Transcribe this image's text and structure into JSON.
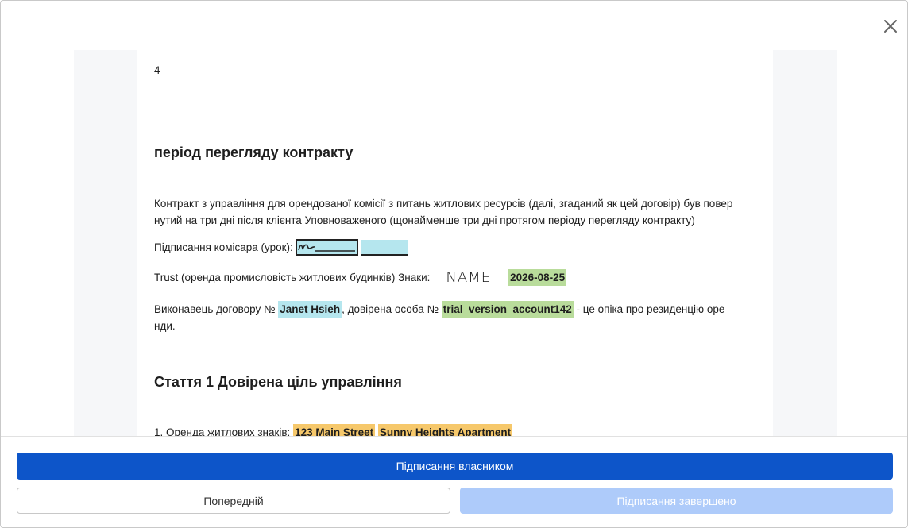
{
  "document": {
    "page_number": "4",
    "section_title": "період перегляду контракту",
    "paragraph_line1": "Контракт з управління для орендованої комісії з питань житлових ресурсів (далі, згаданий як цей договір) був повер",
    "paragraph_line2": "нутий на три дні після клієнта Уповноваженого (щонайменше три дні протягом періоду перегляду контракту)",
    "signature_label": "Підписання комісара (урок):",
    "trust_label": "Trust (оренда промисловість житлових будинків) Знаки:",
    "name_stamp": "NAME",
    "trust_date": "2026-08-25",
    "executor_prefix": "Виконавець договору №",
    "executor_name": "Janet Hsieh",
    "executor_middle": ", довірена особа №",
    "account_id": "trial_version_account142",
    "executor_suffix": " - це опіка про резиденцію оре",
    "executor_suffix_line2": "нди.",
    "article_title": "Стаття 1 Довірена ціль управління",
    "item1_label": "1. Оренда житлових знаків:",
    "item1_street": "123 Main Street",
    "item1_apartment": "Sunny Heights Apartment"
  },
  "footer": {
    "sign_owner_label": "Підписання власником",
    "previous_label": "Попередній",
    "completed_label": "Підписання завершено"
  },
  "colors": {
    "primary": "#0d55c9",
    "disabled": "#aecbfa",
    "highlight_blue": "#b5e6ee",
    "highlight_green": "#b9dc9b",
    "highlight_orange": "#f6c86b"
  }
}
